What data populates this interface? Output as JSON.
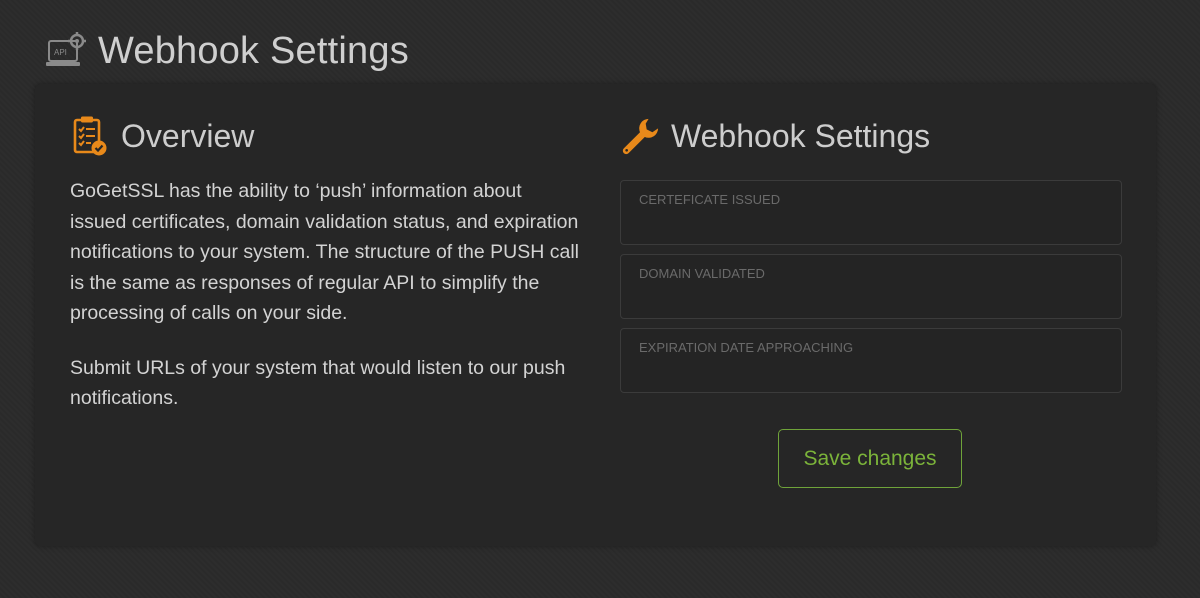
{
  "header": {
    "title": "Webhook Settings",
    "icon": "api-gear-icon",
    "icon_text": "API"
  },
  "overview": {
    "title": "Overview",
    "icon": "clipboard-check-icon",
    "paragraphs": [
      "GoGetSSL has the ability to ‘push’ information about issued certificates, domain validation status, and expiration notifications to your system. The structure of the PUSH call is the same as responses of regular API to simplify the processing of calls on your side.",
      "Submit URLs of your system that would listen to our push notifications."
    ]
  },
  "webhook": {
    "title": "Webhook Settings",
    "icon": "wrench-icon",
    "fields": [
      {
        "label": "CERTEFICATE ISSUED",
        "value": ""
      },
      {
        "label": "DOMAIN VALIDATED",
        "value": ""
      },
      {
        "label": "EXPIRATION DATE APPROACHING",
        "value": ""
      }
    ],
    "save_label": "Save changes"
  },
  "colors": {
    "accent_orange": "#e8891a",
    "save_green": "#7bb33a",
    "panel_bg": "#262626",
    "page_bg": "#2b2b2b"
  }
}
